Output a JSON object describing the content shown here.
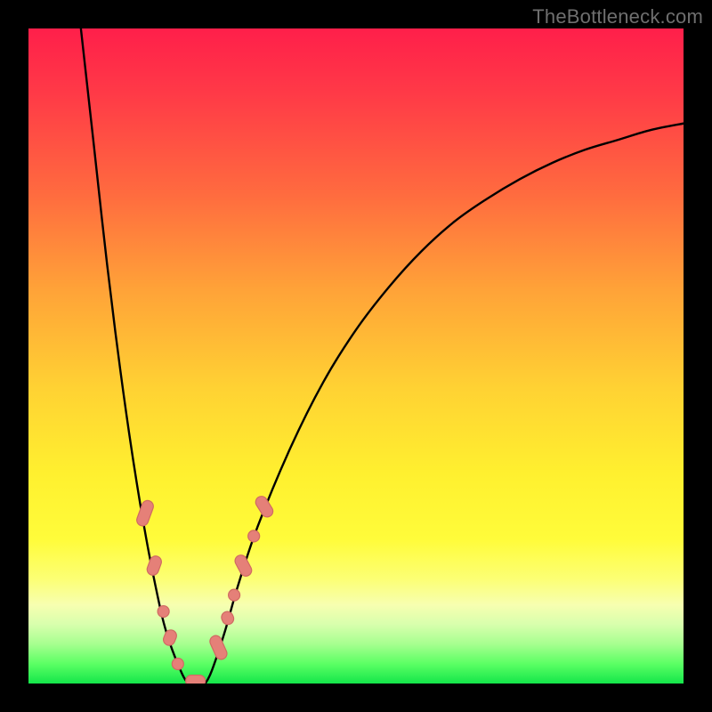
{
  "watermark": "TheBottleneck.com",
  "colors": {
    "background": "#000000",
    "curve": "#000000",
    "marker_fill": "#e58078",
    "marker_stroke": "#d06a62"
  },
  "chart_data": {
    "type": "line",
    "title": "",
    "xlabel": "",
    "ylabel": "",
    "xlim": [
      0,
      100
    ],
    "ylim": [
      0,
      100
    ],
    "grid": false,
    "legend": false,
    "series": [
      {
        "name": "left-curve",
        "x": [
          8.0,
          10.0,
          12.0,
          14.0,
          16.0,
          18.0,
          20.0,
          21.0,
          22.0,
          23.0,
          24.0,
          25.0
        ],
        "values": [
          100.0,
          82.0,
          64.0,
          48.0,
          34.0,
          22.0,
          12.0,
          8.0,
          5.0,
          2.5,
          0.5,
          0.0
        ]
      },
      {
        "name": "right-curve",
        "x": [
          27.0,
          28.0,
          30.0,
          32.0,
          35.0,
          40.0,
          45.0,
          50.0,
          55.0,
          60.0,
          65.0,
          70.0,
          75.0,
          80.0,
          85.0,
          90.0,
          95.0,
          100.0
        ],
        "values": [
          0.0,
          2.0,
          8.0,
          15.0,
          24.0,
          36.0,
          46.0,
          54.0,
          60.5,
          66.0,
          70.5,
          74.0,
          77.0,
          79.5,
          81.5,
          83.0,
          84.5,
          85.5
        ]
      }
    ],
    "markers": [
      {
        "shape": "capsule",
        "x": 17.8,
        "y": 26.0,
        "rotation_deg": -70,
        "length": 4.0
      },
      {
        "shape": "capsule",
        "x": 19.2,
        "y": 18.0,
        "rotation_deg": -70,
        "length": 3.0
      },
      {
        "shape": "dot",
        "x": 20.6,
        "y": 11.0
      },
      {
        "shape": "capsule",
        "x": 21.6,
        "y": 7.0,
        "rotation_deg": -68,
        "length": 2.4
      },
      {
        "shape": "dot",
        "x": 22.8,
        "y": 3.0
      },
      {
        "shape": "capsule",
        "x": 25.5,
        "y": 0.4,
        "rotation_deg": 0,
        "length": 3.0
      },
      {
        "shape": "capsule",
        "x": 29.0,
        "y": 5.5,
        "rotation_deg": 66,
        "length": 3.8
      },
      {
        "shape": "capsule",
        "x": 30.4,
        "y": 10.0,
        "rotation_deg": 66,
        "length": 2.0
      },
      {
        "shape": "dot",
        "x": 31.4,
        "y": 13.5
      },
      {
        "shape": "capsule",
        "x": 32.8,
        "y": 18.0,
        "rotation_deg": 62,
        "length": 3.4
      },
      {
        "shape": "dot",
        "x": 34.4,
        "y": 22.5
      },
      {
        "shape": "capsule",
        "x": 36.0,
        "y": 27.0,
        "rotation_deg": 58,
        "length": 3.4
      }
    ]
  }
}
